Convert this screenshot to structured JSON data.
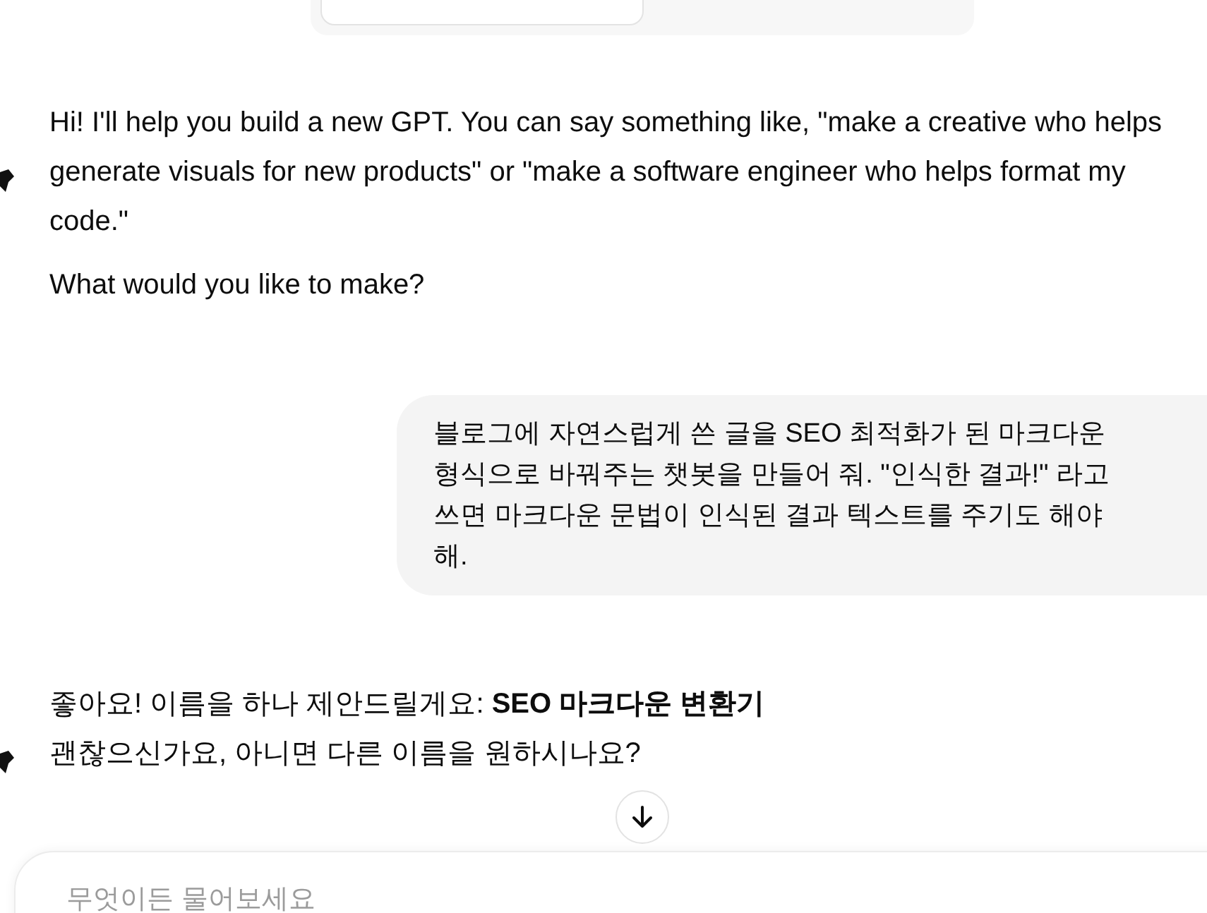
{
  "tabs": [
    {
      "selected": true
    },
    {
      "selected": false
    }
  ],
  "messages": [
    {
      "kind": "assistant",
      "paragraphs": [
        "Hi! I'll help you build a new GPT. You can say something like, \"make a creative who helps generate visuals for new products\" or \"make a software engineer who helps format my code.\"",
        "What would you like to make?"
      ]
    },
    {
      "kind": "user",
      "paragraphs": [
        "블로그에 자연스럽게 쓴 글을 SEO 최적화가 된 마크다운 형식으로 바꿔주는 챗봇을 만들어 줘. \"인식한 결과!\" 라고 쓰면 마크다운 문법이 인식된 결과 텍스트를 주기도 해야 해."
      ]
    },
    {
      "kind": "assistant",
      "paragraphs": [
        "좋아요! 이름을 하나 제안드릴게요: **SEO 마크다운 변환기**",
        "괜찮으신가요, 아니면 다른 이름을 원하시나요?"
      ]
    }
  ],
  "composer": {
    "placeholder": "무엇이든 물어보세요"
  }
}
